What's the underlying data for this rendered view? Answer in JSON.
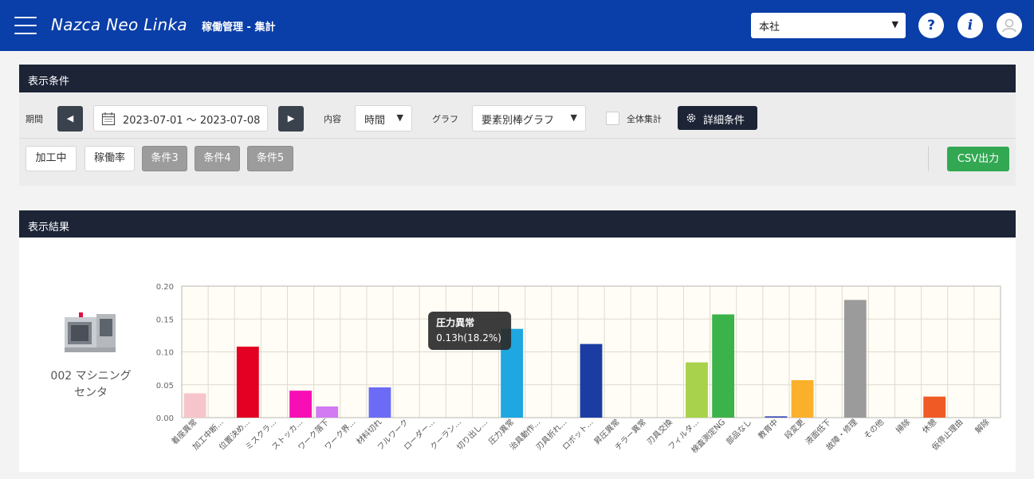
{
  "header": {
    "app_title": "Nazca Neo Linka",
    "page_title": "稼働管理 - 集計",
    "site_select": "本社",
    "help_icon": "?",
    "info_icon": "i"
  },
  "conditions": {
    "title": "表示条件",
    "period_label": "期間",
    "date_range": "2023-07-01 ～ 2023-07-08",
    "content_label": "内容",
    "content_value": "時間",
    "graph_label": "グラフ",
    "graph_value": "要素別棒グラフ",
    "aggregate_label": "全体集計",
    "detail_button": "詳細条件",
    "tags": [
      "加工中",
      "稼働率",
      "条件3",
      "条件4",
      "条件5"
    ],
    "csv_button": "CSV出力"
  },
  "results": {
    "title": "表示結果",
    "machine_name_line1": "002 マシニング",
    "machine_name_line2": "センタ"
  },
  "tooltip": {
    "title": "圧力異常",
    "value": "0.13h(18.2%)"
  },
  "chart_data": {
    "type": "bar",
    "ylim": [
      0,
      0.2
    ],
    "yticks": [
      "0.00",
      "0.05",
      "0.10",
      "0.15",
      "0.20"
    ],
    "grid": true,
    "categories": [
      "着座異常",
      "加工中断...",
      "位置決め...",
      "ミスクラ...",
      "ストッカ...",
      "ワーク落下",
      "ワーク界...",
      "材料切れ",
      "フルワーク",
      "ローダー...",
      "クーラン...",
      "切り出し...",
      "圧力異常",
      "治具動作...",
      "刃具折れ...",
      "ロボット...",
      "昇圧異常",
      "チラー異常",
      "刃具交換",
      "フィルタ...",
      "検査測定NG",
      "部品なし",
      "教育中",
      "段変更",
      "液面低下",
      "故障・修理",
      "その他",
      "掃除",
      "休憩",
      "仮停止理由",
      "解除"
    ],
    "values": [
      0.037,
      0,
      0.108,
      0,
      0.041,
      0.017,
      0,
      0.046,
      0,
      0,
      0,
      0,
      0.135,
      0,
      0,
      0.112,
      0,
      0,
      0,
      0.084,
      0.157,
      0,
      0.002,
      0.057,
      0,
      0.179,
      0,
      0,
      0.032,
      0,
      0
    ],
    "colors": [
      "#f6c5cb",
      "#cccccc",
      "#e30022",
      "#cccccc",
      "#f70fb5",
      "#d17af2",
      "#cccccc",
      "#6b6bf6",
      "#cccccc",
      "#cccccc",
      "#cccccc",
      "#cccccc",
      "#1ea7e0",
      "#cccccc",
      "#cccccc",
      "#1b3da3",
      "#cccccc",
      "#cccccc",
      "#cccccc",
      "#a8d24b",
      "#3cb34a",
      "#cccccc",
      "#3a4ab8",
      "#fbb02c",
      "#cccccc",
      "#9b9b9b",
      "#cccccc",
      "#cccccc",
      "#f05a24",
      "#cccccc",
      "#cccccc"
    ]
  }
}
